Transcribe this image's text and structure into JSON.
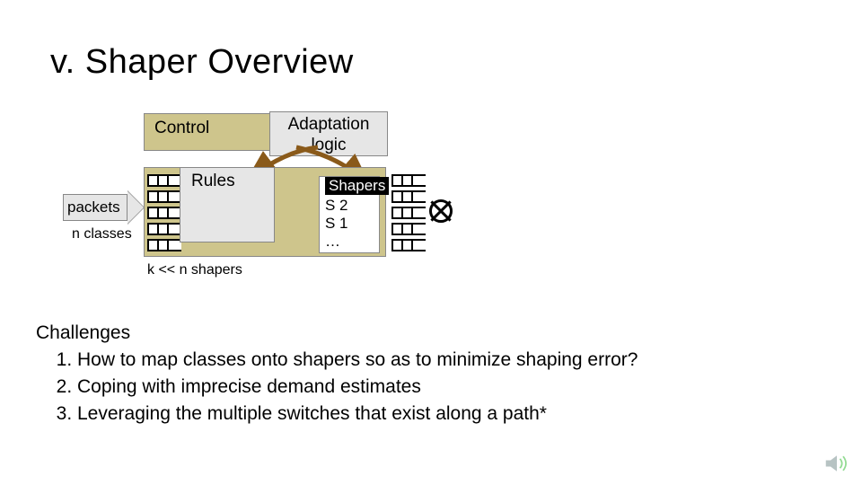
{
  "title": "v. Shaper Overview",
  "control": {
    "label": "Control"
  },
  "adaptation": {
    "line1": "Adaptation",
    "line2": "logic"
  },
  "packets": {
    "label": "packets",
    "sub": "n classes"
  },
  "rules": {
    "label": "Rules"
  },
  "shapers": {
    "header": "Shapers",
    "s2": "S 2",
    "s1": "S 1",
    "ell": "…"
  },
  "kline": "k << n shapers",
  "challenges": {
    "heading": "Challenges",
    "items": [
      "How to map classes onto shapers so as to minimize shaping error?",
      "Coping with imprecise demand estimates",
      "Leveraging the multiple switches that exist along a path*"
    ]
  },
  "icons": {
    "sound": "speaker-icon"
  }
}
